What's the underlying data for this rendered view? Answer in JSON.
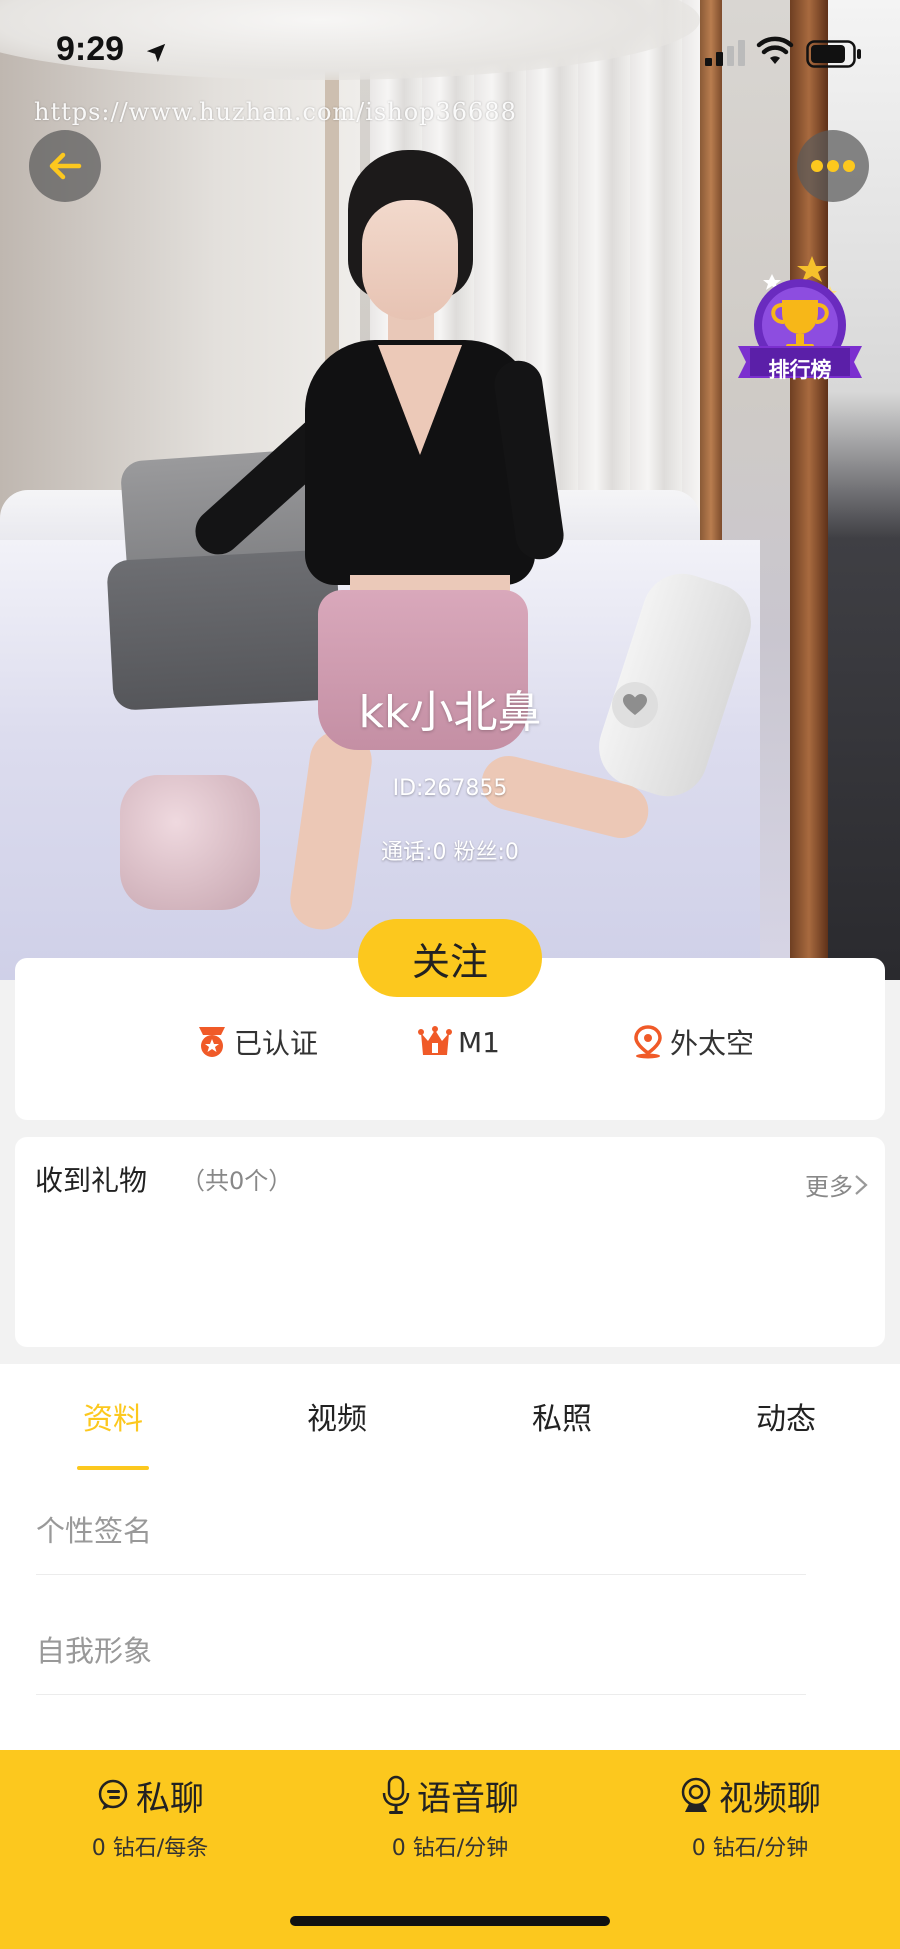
{
  "status_bar": {
    "time": "9:29"
  },
  "watermark": "https://www.huzhan.com/ishop36688",
  "header": {
    "rank_label": "排行榜"
  },
  "profile": {
    "nickname": "kk小北鼻",
    "id_text": "ID:267855",
    "stats_text": "通话:0 粉丝:0",
    "follow_label": "关注"
  },
  "badges": [
    {
      "label": "已认证",
      "icon": "verified-medal-icon"
    },
    {
      "label": "M1",
      "icon": "crown-icon"
    },
    {
      "label": "外太空",
      "icon": "location-pin-icon"
    }
  ],
  "gifts": {
    "title": "收到礼物",
    "count": "（共0个）",
    "more": "更多"
  },
  "tabs": [
    {
      "label": "资料",
      "active": true
    },
    {
      "label": "视频",
      "active": false
    },
    {
      "label": "私照",
      "active": false
    },
    {
      "label": "动态",
      "active": false
    }
  ],
  "profile_fields": [
    {
      "placeholder": "个性签名"
    },
    {
      "placeholder": "自我形象"
    }
  ],
  "actions": [
    {
      "label": "私聊",
      "price": "0 钻石/每条",
      "icon": "chat-bubble-icon"
    },
    {
      "label": "语音聊",
      "price": "0 钻石/分钟",
      "icon": "microphone-icon"
    },
    {
      "label": "视频聊",
      "price": "0 钻石/分钟",
      "icon": "camera-icon"
    }
  ],
  "colors": {
    "accent": "#fcc81e",
    "badge_orange": "#f05a28"
  }
}
